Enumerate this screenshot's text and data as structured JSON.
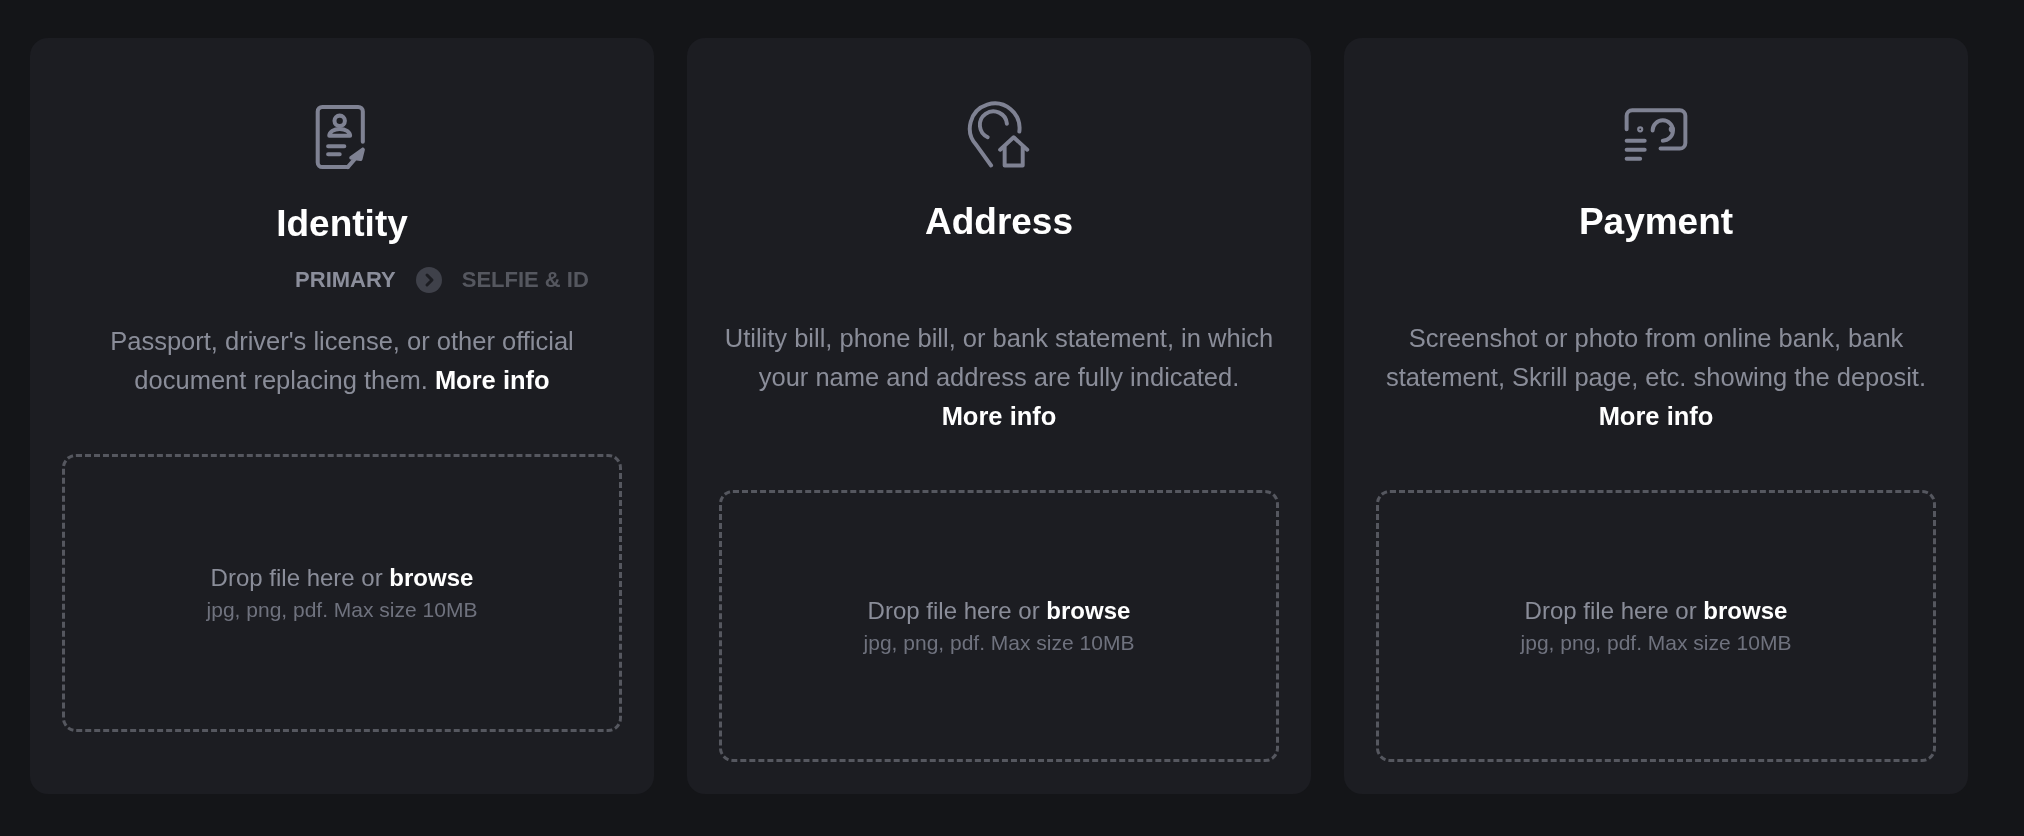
{
  "cards": [
    {
      "kind": "id-document",
      "title": "Identity",
      "steps": [
        {
          "label": "PRIMARY",
          "selected": true
        },
        {
          "label": "SELFIE & ID",
          "selected": false
        }
      ],
      "description": "Passport, driver's license, or other official document replacing them.",
      "link": "More info",
      "dropzone": {
        "prompt": "Drop file here or",
        "action": "browse",
        "hint": "jpg, png, pdf. Max size 10MB"
      }
    },
    {
      "kind": "location-home",
      "title": "Address",
      "description": "Utility bill, phone bill, or bank statement, in which your name and address are fully indicated.",
      "link": "More info",
      "dropzone": {
        "prompt": "Drop file here or",
        "action": "browse",
        "hint": "jpg, png, pdf. Max size 10MB"
      }
    },
    {
      "kind": "banknote",
      "title": "Payment",
      "description": "Screenshot or photo from online bank, bank statement, Skrill page, etc. showing the deposit.",
      "link": "More info",
      "dropzone": {
        "prompt": "Drop file here or",
        "action": "browse",
        "hint": "jpg, png, pdf. Max size 10MB"
      }
    }
  ]
}
